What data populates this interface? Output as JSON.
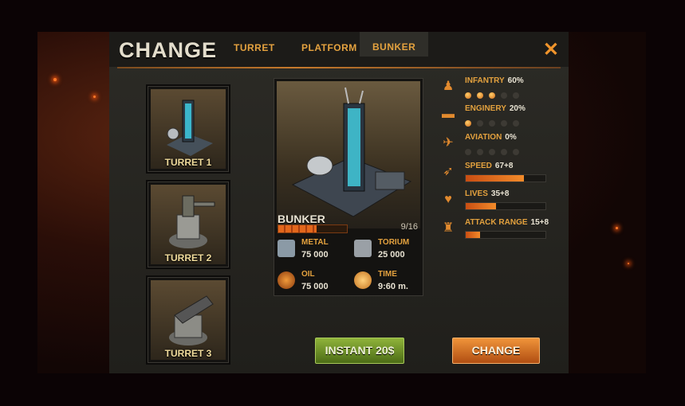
{
  "header": {
    "title": "CHANGE",
    "tabs": [
      {
        "label": "TURRET",
        "active": false
      },
      {
        "label": "PLATFORM",
        "active": false
      },
      {
        "label": "BUNKER",
        "active": true
      }
    ],
    "close_icon": "close-x-icon"
  },
  "cards": [
    {
      "label": "TURRET 1"
    },
    {
      "label": "TURRET 2"
    },
    {
      "label": "TURRET 3"
    }
  ],
  "selected": {
    "name": "BUNKER",
    "count": "9/16",
    "progress": 0.5625,
    "resources": [
      {
        "name": "METAL",
        "value": "75 000",
        "icon": "metal-icon"
      },
      {
        "name": "TORIUM",
        "value": "25 000",
        "icon": "torium-icon"
      },
      {
        "name": "OIL",
        "value": "75 000",
        "icon": "oil-icon"
      },
      {
        "name": "TIME",
        "value": "9:60 m.",
        "icon": "clock-icon"
      }
    ]
  },
  "stats": [
    {
      "name": "INFANTRY",
      "value": "60%",
      "dots_on": 3,
      "dots_total": 5,
      "icon": "infantry-icon"
    },
    {
      "name": "ENGINERY",
      "value": "20%",
      "dots_on": 1,
      "dots_total": 5,
      "icon": "tank-icon"
    },
    {
      "name": "AVIATION",
      "value": "0%",
      "dots_on": 0,
      "dots_total": 5,
      "icon": "jet-icon"
    },
    {
      "name": "SPEED",
      "value": "67+8",
      "fill": 0.73,
      "icon": "wing-icon"
    },
    {
      "name": "LIVES",
      "value": "35+8",
      "fill": 0.38,
      "icon": "heart-icon"
    },
    {
      "name": "ATTACK RANGE",
      "value": "15+8",
      "fill": 0.18,
      "icon": "trophy-icon"
    }
  ],
  "buttons": {
    "instant": "INSTANT  20$",
    "change": "CHANGE"
  },
  "colors": {
    "accent": "#e3a13e",
    "primary_button": "#e0782a",
    "instant_button": "#7a9d2e"
  }
}
